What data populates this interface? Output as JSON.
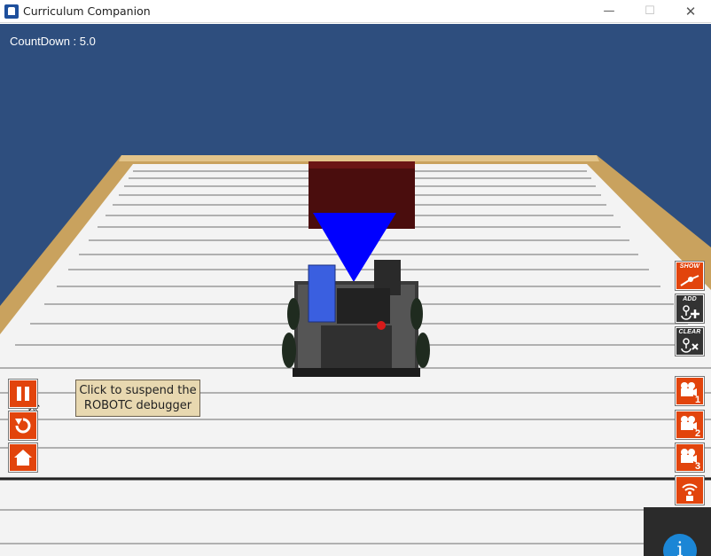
{
  "window": {
    "title": "Curriculum Companion",
    "minimize_glyph": "—",
    "maximize_glyph": "☐",
    "close_glyph": "✕"
  },
  "hud": {
    "countdown": "CountDown : 5.0"
  },
  "right_toolbar": {
    "show_label": "SHOW",
    "add_label": "ADD",
    "clear_label": "CLEAR",
    "camera_1_label": "1",
    "camera_2_label": "2",
    "camera_3_label": "3"
  },
  "tooltip": {
    "line1": "Click to suspend the",
    "line2": "ROBOTC debugger"
  },
  "info": {
    "glyph": "i"
  },
  "colors": {
    "sky": "#2e4e7e",
    "button_orange": "#e2440c",
    "button_dark": "#333333",
    "tooltip_bg": "#e8d8b0",
    "field_border": "#c8a060",
    "sensor_cone": "#0000ff",
    "robot_battery": "#3a5fe0"
  },
  "icons": [
    "pause-icon",
    "reset-icon",
    "home-icon",
    "show-path-icon",
    "add-icon",
    "clear-icon",
    "camera-icon",
    "wifi-icon",
    "info-icon"
  ]
}
